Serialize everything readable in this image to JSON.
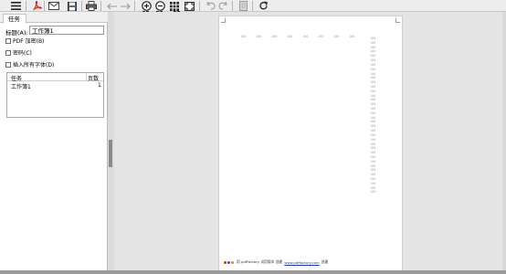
{
  "toolbar": {
    "zoom_in_label": "1",
    "zoom_out_label": "2",
    "fit_label": "0"
  },
  "left_panel": {
    "tab_label": "任务",
    "title_label": "标题(A):",
    "title_value": "工作簿1",
    "options": [
      {
        "label": "PDF 加密(B)",
        "checked": false
      },
      {
        "label": "密码(C)",
        "checked": false
      },
      {
        "label": "插入所有字体(D)",
        "checked": false
      }
    ],
    "task_table": {
      "headers": [
        "任务",
        "页数"
      ],
      "rows": [
        [
          "工作簿1",
          "1"
        ]
      ]
    }
  },
  "page": {
    "header_numbers": [
      "100",
      "100",
      "100",
      "100",
      "100",
      "100",
      "100",
      "100"
    ],
    "column_numbers": [
      "100",
      "100",
      "100",
      "100",
      "100",
      "100",
      "100",
      "100",
      "100",
      "100",
      "100",
      "100",
      "100",
      "100",
      "100",
      "100",
      "100",
      "100",
      "100",
      "100",
      "100",
      "100",
      "100",
      "100",
      "100",
      "100",
      "100",
      "100",
      "100",
      "100",
      "100",
      "100",
      "100",
      "100",
      "100",
      "100"
    ],
    "footer_text_1": "用 pdfFactory 试用版本 创建 ",
    "footer_link": "www.pdffactory.com",
    "footer_text_2": " 创建"
  },
  "colors": {
    "pdf_red": "#d9261c",
    "accent_blue": "#1a3cc8",
    "footer_dot_1": "#c0392b",
    "footer_dot_2": "#2c5fb3",
    "footer_dot_3": "#e08a1e"
  }
}
